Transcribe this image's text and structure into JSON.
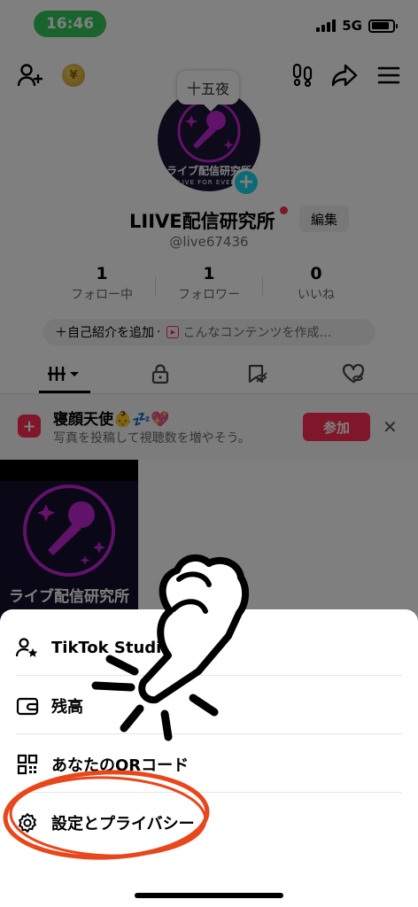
{
  "status": {
    "time": "16:46",
    "network": "5G",
    "battery_level": 0.85
  },
  "profile": {
    "bubble_text": "十五夜",
    "avatar_name": "ライブ配信研究所",
    "avatar_sub": "LIVE FOR EVERY",
    "display_name": "LIIVE配信研究所",
    "name_caret": "⌄",
    "edit_label": "編集",
    "username": "@live67436",
    "stats": [
      {
        "value": "1",
        "label": "フォロー中"
      },
      {
        "value": "1",
        "label": "フォロワー"
      },
      {
        "value": "0",
        "label": "いいね"
      }
    ],
    "bio_add": "＋自己紹介を追加",
    "bio_sep": "·",
    "bio_content": "こんなコンテンツを作成…"
  },
  "tabs": [
    "videos",
    "private",
    "reposts",
    "liked"
  ],
  "banner": {
    "title": "寝顔天使👶💤💖",
    "subtitle": "写真を投稿して視聴数を増やそう。",
    "join_label": "参加",
    "close": "✕"
  },
  "thumbnail": {
    "name": "ライブ配信研究所"
  },
  "sheet": {
    "items": [
      {
        "label": "TikTok Studio",
        "icon": "person-star-icon"
      },
      {
        "label": "残高",
        "icon": "wallet-icon"
      },
      {
        "label": "あなたのQRコード",
        "icon": "qr-code-icon"
      },
      {
        "label": "設定とプライバシー",
        "icon": "gear-icon"
      }
    ]
  },
  "colors": {
    "accent": "#fe2c55",
    "highlight_circle": "#e8471c",
    "time_pill": "#34c759",
    "plus_badge": "#20d5ec"
  }
}
